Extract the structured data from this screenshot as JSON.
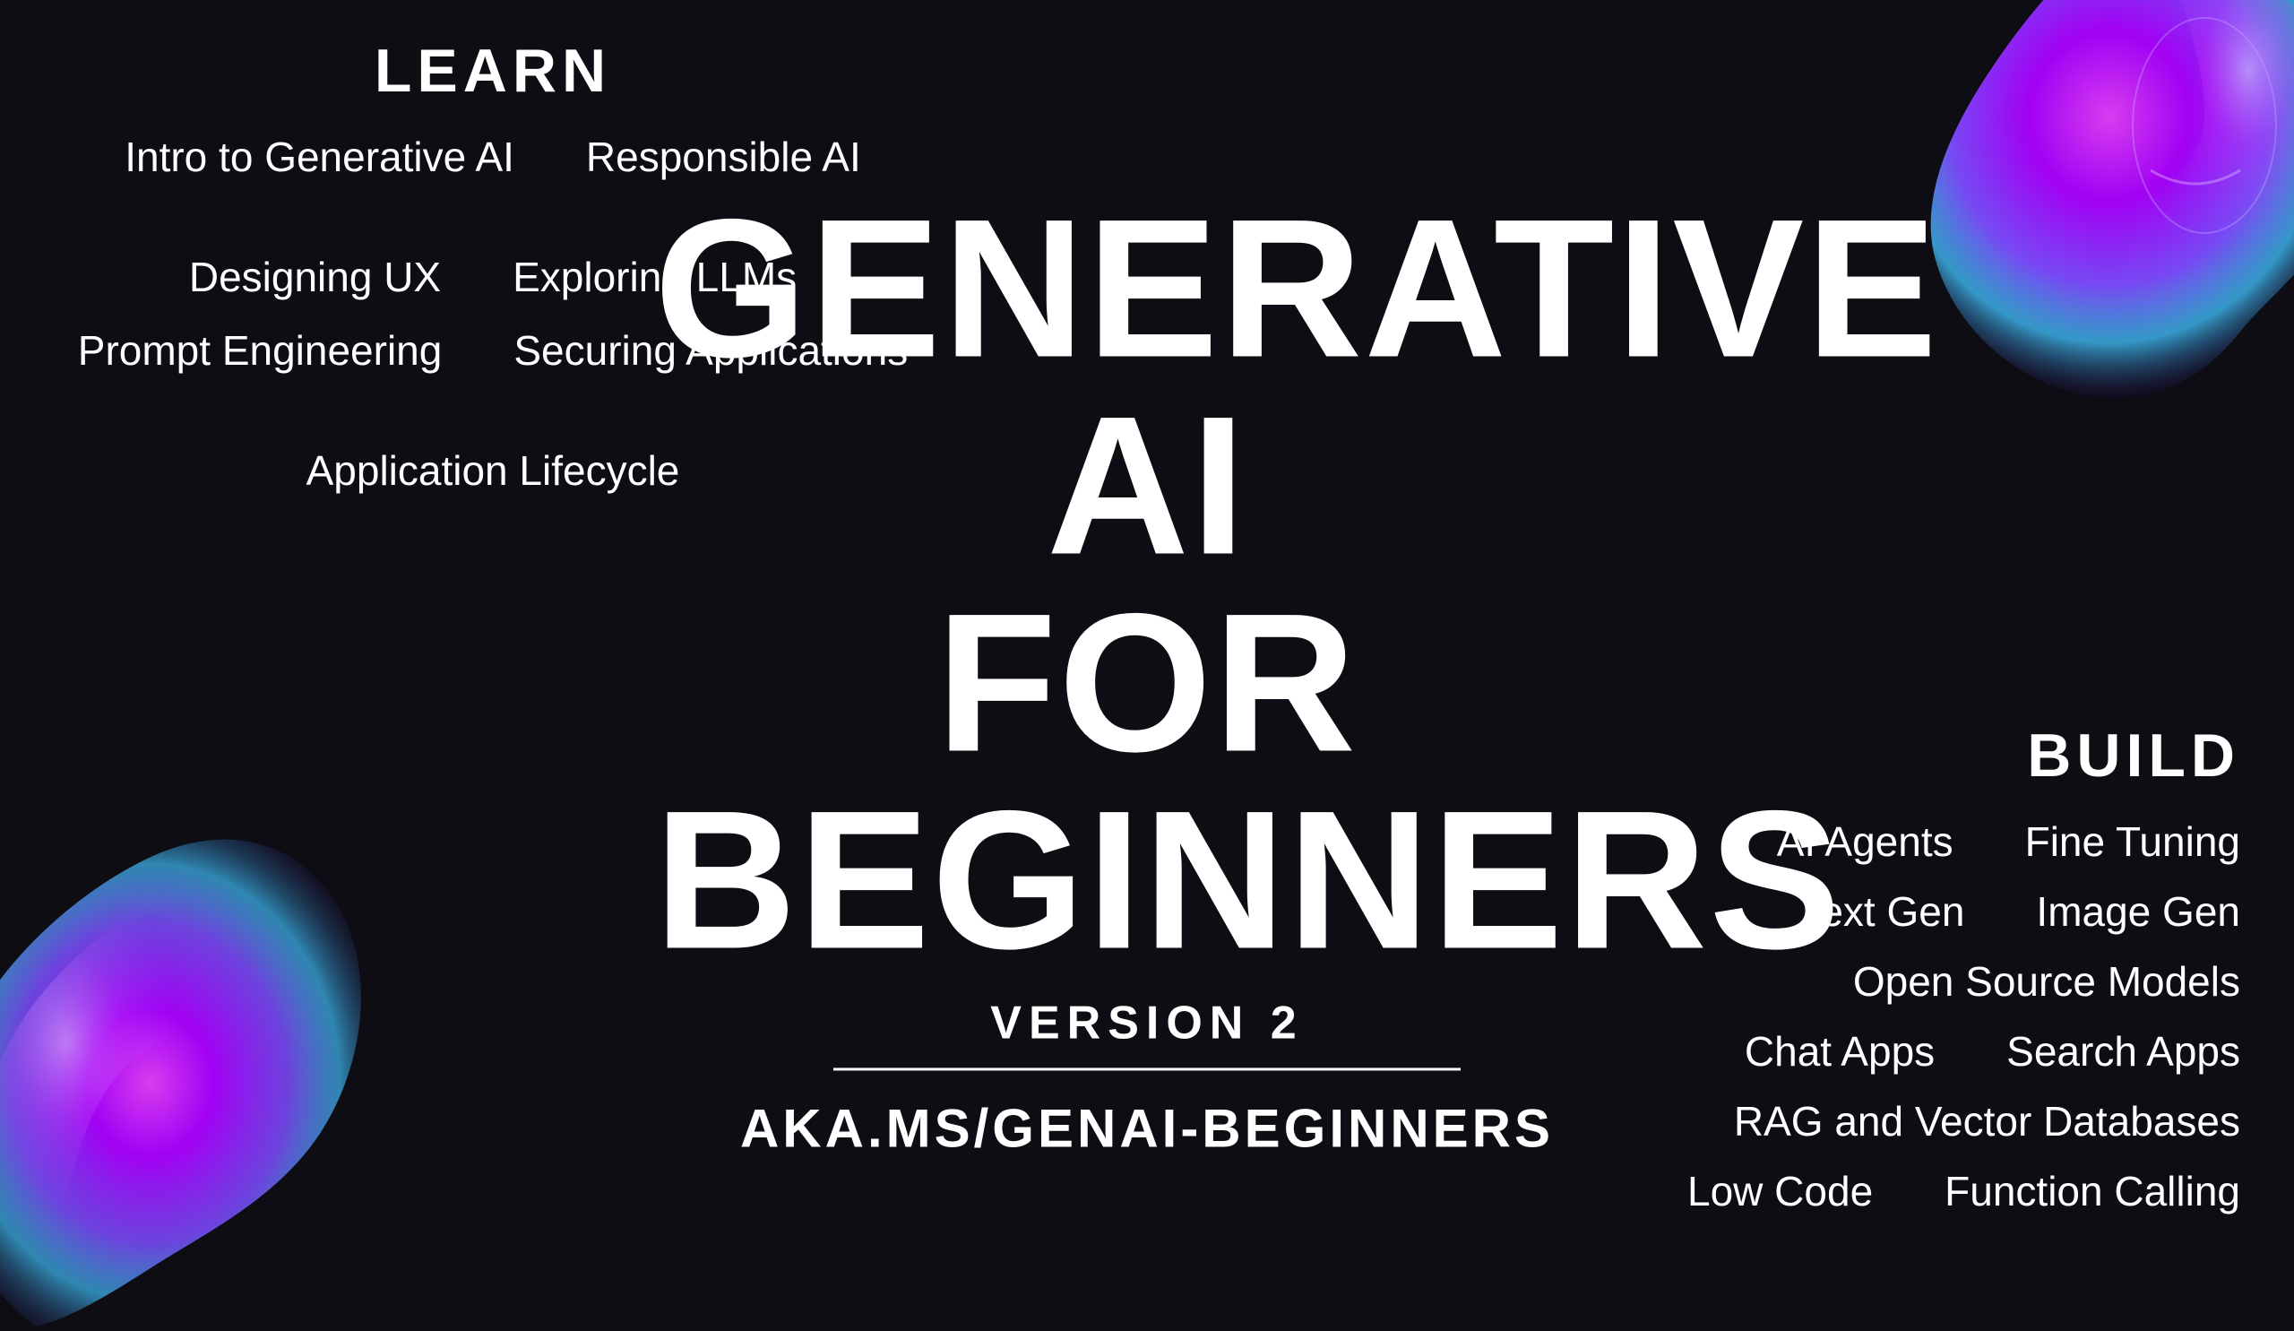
{
  "learn": {
    "title": "LEARN",
    "row1": [
      "Intro to Generative AI",
      "Responsible AI",
      "Designing UX",
      "Exploring LLMs"
    ],
    "row2": [
      "Prompt Engineering",
      "Securing Applications",
      "Application Lifecycle"
    ]
  },
  "main": {
    "line1": "GENERATIVE AI",
    "line2": "FOR",
    "line3": "BEGINNERS",
    "version": "VERSION 2",
    "url": "AKA.MS/GENAI-BEGINNERS"
  },
  "build": {
    "title": "BUILD",
    "row1": [
      "AI Agents",
      "Fine Tuning"
    ],
    "row2": [
      "Text Gen",
      "Image Gen"
    ],
    "row3": [
      "Open Source Models"
    ],
    "row4": [
      "Chat Apps",
      "Search Apps"
    ],
    "row5": [
      "RAG and Vector Databases"
    ],
    "row6": [
      "Low Code",
      "Function Calling"
    ]
  }
}
